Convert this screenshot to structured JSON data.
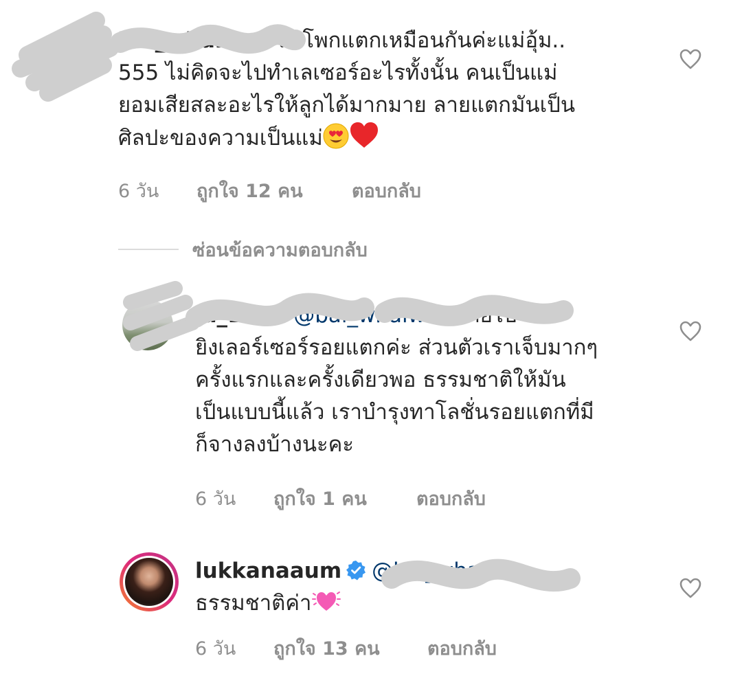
{
  "comments": [
    {
      "username": "bai_whaiwan",
      "text": "สะโพกแตกเหมือนกันค่ะแม่อุ้ม.. 555 ไม่คิดจะไปทำเลเซอร์อะไรทั้งนั้น คนเป็นแม่ ยอมเสียสละอะไรให้ลูกได้มากมาย ลายแตกมันเป็น ศิลปะของความเป็นแม่",
      "line1_rest": "สะโพกแตกเหมือนกันค่ะแม่อุ้ม..",
      "line2": "555 ไม่คิดจะไปทำเลเซอร์อะไรทั้งนั้น คนเป็นแม่",
      "line3": "ยอมเสียสละอะไรให้ลูกได้มากมาย ลายแตกมันเป็น",
      "line4": "ศิลปะของความเป็นแม่",
      "emojis": [
        "heart-eyes-emoji",
        "red-heart-emoji"
      ],
      "time": "6 วัน",
      "likes": "ถูกใจ 12 คน",
      "reply": "ตอบกลับ"
    },
    {
      "username": "ja_1990",
      "mention": "@bai_whaiwan",
      "line1_rest": "เคยไป",
      "line2": "ยิงเลอร์เซอร์รอยแตกค่ะ ส่วนตัวเราเจ็บมากๆ",
      "line3": "ครั้งแรกและครั้งเดียวพอ ธรรมชาติให้มัน",
      "line4": "เป็นแบบนี้แล้ว เราบำรุงทาโลชั่นรอยแตกที่มี",
      "line5": "ก็จางลงบ้างนะคะ",
      "time": "6 วัน",
      "likes": "ถูกใจ 1 คน",
      "reply": "ตอบกลับ"
    },
    {
      "username": "lukkanaaum",
      "mention": "@bai_whaiwan",
      "line2": "ธรรมชาติค่า",
      "emojis": [
        "sparkling-heart-emoji"
      ],
      "time": "6 วัน",
      "likes": "ถูกใจ 13 คน",
      "reply": "ตอบกลับ"
    }
  ],
  "hide_replies_label": "ซ่อนข้อความตอบกลับ",
  "colors": {
    "text": "#262626",
    "secondary": "#8e8e8e",
    "mention": "#00376b",
    "verified": "#3897f0",
    "heart_outline": "#8e8e8e",
    "story_ring_start": "#f58529",
    "story_ring_end": "#c13584"
  }
}
